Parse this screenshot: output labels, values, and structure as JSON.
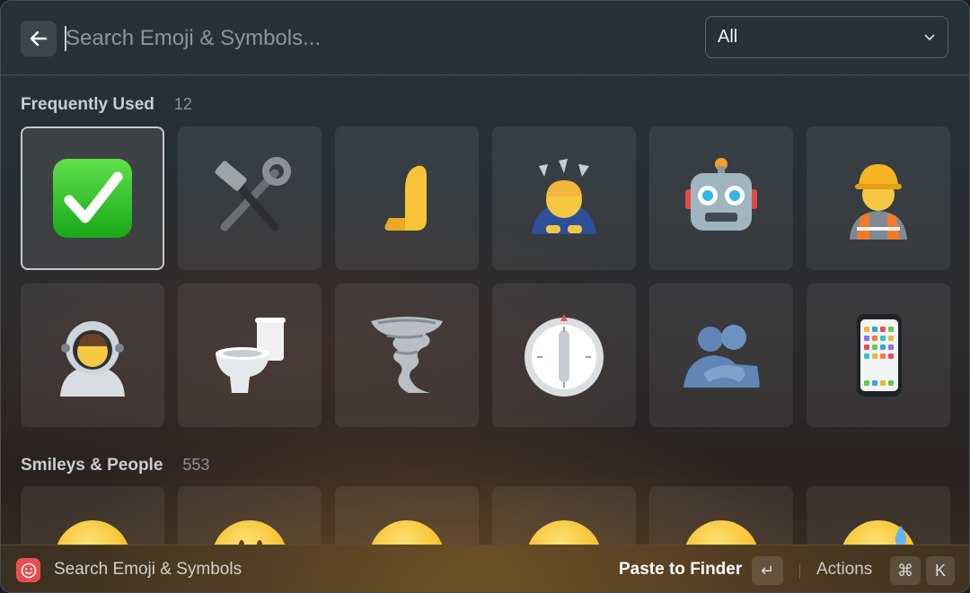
{
  "search": {
    "placeholder": "Search Emoji & Symbols...",
    "value": ""
  },
  "filter": {
    "selected": "All"
  },
  "sections": [
    {
      "title": "Frequently Used",
      "count": "12",
      "items": [
        {
          "name": "check-mark-button",
          "glyph": "✅"
        },
        {
          "name": "hammer-and-wrench",
          "glyph": "🛠️"
        },
        {
          "name": "leftwards-pushing-hand",
          "glyph": "🫷"
        },
        {
          "name": "person-bowing",
          "glyph": "🙇"
        },
        {
          "name": "robot",
          "glyph": "🤖"
        },
        {
          "name": "construction-worker",
          "glyph": "👷"
        },
        {
          "name": "astronaut",
          "glyph": "🧑‍🚀"
        },
        {
          "name": "toilet",
          "glyph": "🚽"
        },
        {
          "name": "tornado",
          "glyph": "🌪️"
        },
        {
          "name": "timer-clock",
          "glyph": "⏲️"
        },
        {
          "name": "people-hugging",
          "glyph": "🫂"
        },
        {
          "name": "mobile-phone",
          "glyph": "📱"
        }
      ]
    },
    {
      "title": "Smileys & People",
      "count": "553",
      "items": [
        {
          "name": "grinning-face",
          "glyph": "😀"
        },
        {
          "name": "smiling-face",
          "glyph": "😃"
        },
        {
          "name": "grinning-face-smiling-eyes",
          "glyph": "😄"
        },
        {
          "name": "beaming-face",
          "glyph": "😁"
        },
        {
          "name": "grinning-squinting-face",
          "glyph": "😆"
        },
        {
          "name": "grinning-face-sweat",
          "glyph": "😅"
        }
      ]
    }
  ],
  "footer": {
    "title": "Search Emoji & Symbols",
    "primary_action": "Paste to Finder",
    "primary_key": "↵",
    "secondary_action": "Actions",
    "secondary_keys": [
      "⌘",
      "K"
    ]
  },
  "colors": {
    "selection_border": "#c7c9cb",
    "footer_icon": "#e94d4f"
  }
}
